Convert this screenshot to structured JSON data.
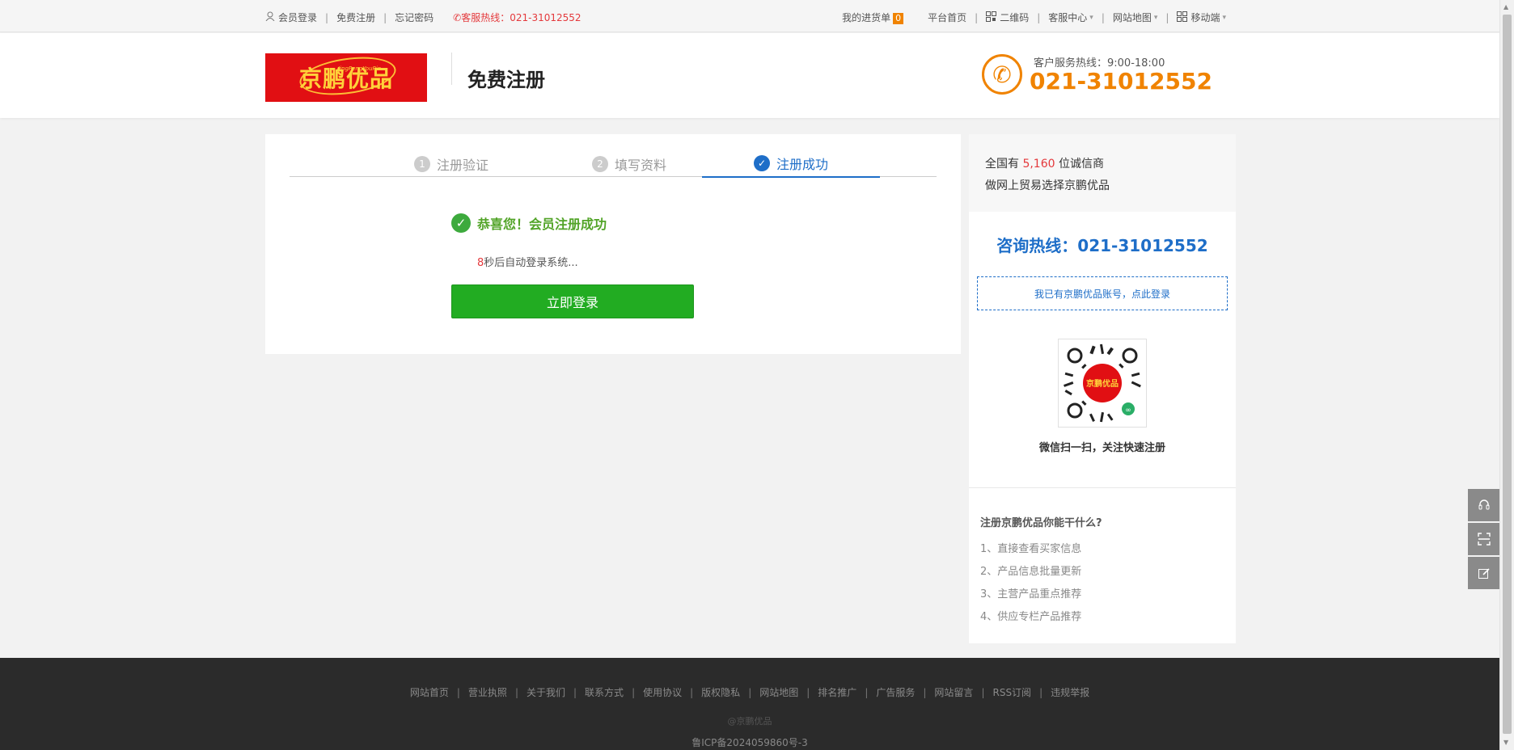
{
  "topbar": {
    "login": "会员登录",
    "register": "免费注册",
    "forgot": "忘记密码",
    "hotline": "客服热线：021-31012552",
    "cart": "我的进货单",
    "cart_count": "0",
    "home": "平台首页",
    "qrcode": "二维码",
    "service": "客服中心",
    "sitemap": "网站地图",
    "mobile": "移动端",
    "icons": {
      "user": "user-icon",
      "phone": "phone-icon",
      "qr": "qrcode-icon",
      "mobile": "grid-icon"
    }
  },
  "header": {
    "logo_text": "京鹏优品",
    "logo_sub": "JingPengYouPin",
    "title": "免费注册",
    "phone_label": "客户服务热线：9:00-18:00",
    "phone_number": "021-31012552"
  },
  "steps": [
    {
      "num": "1",
      "label": "注册验证"
    },
    {
      "num": "2",
      "label": "填写资料"
    },
    {
      "num": "✓",
      "label": "注册成功"
    }
  ],
  "result": {
    "title": "恭喜您！会员注册成功",
    "countdown_num": "8",
    "countdown_text": "秒后自动登录系统...",
    "login_button": "立即登录"
  },
  "side": {
    "line1_pre": "全国有",
    "line1_num": "5,160",
    "line1_post": "位诚信商",
    "line2": "做网上贸易选择京鹏优品",
    "consult": "咨询热线：021-31012552",
    "have_account": "我已有京鹏优品账号，点此登录",
    "qr_caption": "微信扫一扫，关注快速注册",
    "can_title": "注册京鹏优品你能干什么?",
    "can_items": [
      "1、直接查看买家信息",
      "2、产品信息批量更新",
      "3、主营产品重点推荐",
      "4、供应专栏产品推荐"
    ]
  },
  "float_tools": [
    "headset-icon",
    "scan-icon",
    "edit-icon"
  ],
  "footer": {
    "links": [
      "网站首页",
      "营业执照",
      "关于我们",
      "联系方式",
      "使用协议",
      "版权隐私",
      "网站地图",
      "排名推广",
      "广告服务",
      "网站留言",
      "RSS订阅",
      "违规举报"
    ],
    "copyright": "@京鹏优品",
    "icp": "鲁ICP备2024059860号-3"
  },
  "colors": {
    "accent": "#1e6ec8",
    "success": "#22ac22",
    "orange": "#f08300",
    "red": "#e4393c"
  }
}
